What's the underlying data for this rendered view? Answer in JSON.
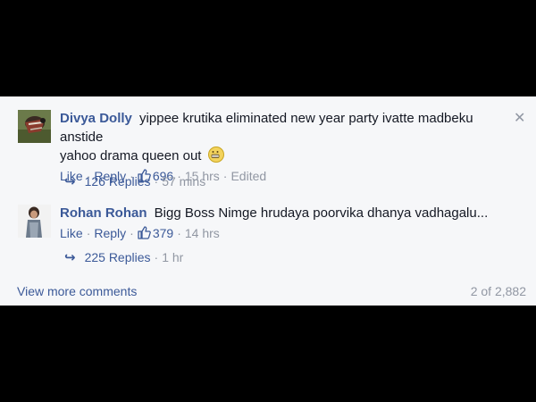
{
  "comments": [
    {
      "author": "Divya Dolly",
      "text_line1": "yippee krutika eliminated new year party ivatte madbeku anstide",
      "text_line2": "yahoo drama queen out",
      "like_label": "Like",
      "reply_label": "Reply",
      "likes": "696",
      "time": "15 hrs",
      "edited": "Edited",
      "replies_label": "126 Replies",
      "replies_time": "57 mins"
    },
    {
      "author": "Rohan Rohan",
      "text_line1": "Bigg Boss Nimge hrudaya poorvika dhanya vadhagalu...",
      "like_label": "Like",
      "reply_label": "Reply",
      "likes": "379",
      "time": "14 hrs",
      "replies_label": "225 Replies",
      "replies_time": "1 hr"
    }
  ],
  "footer": {
    "view_more": "View more comments",
    "count": "2 of 2,882"
  },
  "icons": {
    "close": "close-icon",
    "thumbs_up": "thumbs-up-icon",
    "reply_arrow": "reply-arrow-icon",
    "emoji": "grimace-emoji-icon"
  },
  "colors": {
    "link": "#3b5998",
    "meta": "#9197a3",
    "panel_bg": "#f6f7f9"
  }
}
